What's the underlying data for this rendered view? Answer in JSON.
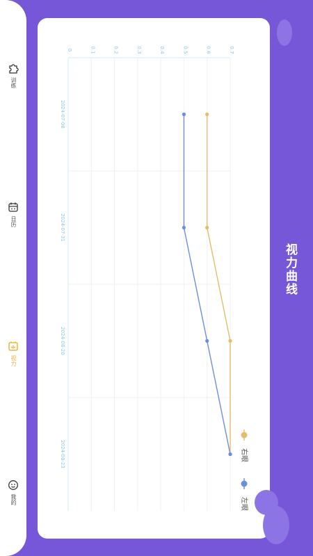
{
  "page_title": "视力曲线",
  "nav": {
    "items": [
      {
        "label": "训练",
        "icon": "puzzle-icon"
      },
      {
        "label": "日历",
        "icon": "calendar-icon"
      },
      {
        "label": "视力",
        "icon": "vision-icon",
        "active": true
      },
      {
        "label": "我的",
        "icon": "profile-icon"
      }
    ]
  },
  "colors": {
    "background": "#7557d8",
    "active_tab": "#f2b33a",
    "right_eye": "#e5bd6a",
    "left_eye": "#6b8ee0"
  },
  "chart_data": {
    "type": "line",
    "orientation": "rotated 90 degrees clockwise",
    "categories": [
      "2024-07-08",
      "2024-07-31",
      "2024-08-20",
      "2024-08-23"
    ],
    "series": [
      {
        "name": "右眼",
        "values": [
          0.6,
          0.6,
          0.7,
          0.7
        ]
      },
      {
        "name": "左眼",
        "values": [
          0.5,
          0.5,
          0.6,
          0.7
        ]
      }
    ],
    "ylim": [
      0,
      0.7
    ],
    "yticks": [
      "0",
      "0.1",
      "0.2",
      "0.3",
      "0.4",
      "0.5",
      "0.6",
      "0.7"
    ],
    "grid": true,
    "legend": "bottom"
  }
}
